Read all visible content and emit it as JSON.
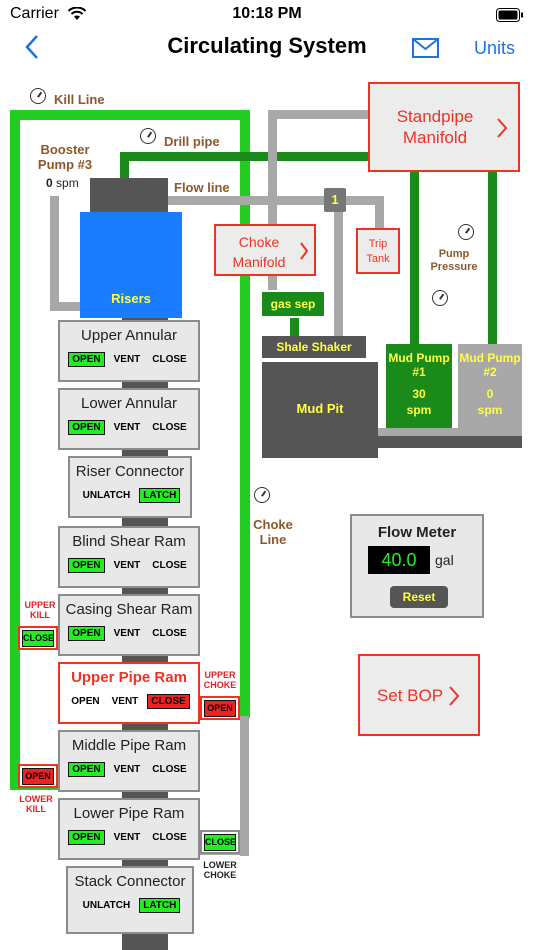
{
  "status_bar": {
    "carrier": "Carrier",
    "time": "10:18 PM"
  },
  "nav": {
    "title": "Circulating System",
    "units": "Units",
    "back_icon": "chevron-left-icon",
    "mail_icon": "mail-icon"
  },
  "colors": {
    "kill_line": "#22cc22",
    "drill_pipe": "#1a8a1a",
    "choke_line": "#a8a8a8",
    "accent": "#1a73e8",
    "alert": "#ee3322"
  },
  "labels": {
    "kill_line": "Kill Line",
    "drill_pipe": "Drill pipe",
    "booster_pump": "Booster Pump #3",
    "booster_value": "0",
    "booster_unit": "spm",
    "flow_line": "Flow line",
    "risers": "Risers",
    "choke_line": "Choke Line",
    "pump_pressure": "Pump Pressure",
    "gas_sep": "gas sep",
    "shale_shaker": "Shale Shaker",
    "mud_pit": "Mud Pit",
    "valve_marker": "1"
  },
  "buttons": {
    "standpipe_manifold": "Standpipe Manifold",
    "choke_manifold": "Choke Manifold",
    "trip_tank": "Trip Tank",
    "set_bop": "Set BOP"
  },
  "pumps": [
    {
      "name": "Mud Pump #1",
      "value": "30",
      "unit": "spm"
    },
    {
      "name": "Mud Pump #2",
      "value": "0",
      "unit": "spm"
    }
  ],
  "flow_meter": {
    "title": "Flow Meter",
    "value": "40.0",
    "unit": "gal",
    "reset": "Reset"
  },
  "bop_stack": [
    {
      "title": "Upper Annular",
      "buttons": [
        "OPEN",
        "VENT",
        "CLOSE"
      ],
      "active": 0
    },
    {
      "title": "Lower Annular",
      "buttons": [
        "OPEN",
        "VENT",
        "CLOSE"
      ],
      "active": 0
    },
    {
      "title": "Riser Connector",
      "buttons": [
        "UNLATCH",
        "LATCH"
      ],
      "active": 1
    },
    {
      "title": "Blind Shear Ram",
      "buttons": [
        "OPEN",
        "VENT",
        "CLOSE"
      ],
      "active": 0
    },
    {
      "title": "Casing Shear Ram",
      "buttons": [
        "OPEN",
        "VENT",
        "CLOSE"
      ],
      "active": 0
    },
    {
      "title": "Upper Pipe Ram",
      "buttons": [
        "OPEN",
        "VENT",
        "CLOSE"
      ],
      "active": 2
    },
    {
      "title": "Middle Pipe Ram",
      "buttons": [
        "OPEN",
        "VENT",
        "CLOSE"
      ],
      "active": 0
    },
    {
      "title": "Lower Pipe Ram",
      "buttons": [
        "OPEN",
        "VENT",
        "CLOSE"
      ],
      "active": 0
    },
    {
      "title": "Stack Connector",
      "buttons": [
        "UNLATCH",
        "LATCH"
      ],
      "active": 1
    }
  ],
  "side_valves": {
    "upper_kill": {
      "label": "UPPER KILL",
      "state": "CLOSE"
    },
    "lower_kill": {
      "label": "LOWER KILL",
      "state": "OPEN"
    },
    "upper_choke": {
      "label": "UPPER CHOKE",
      "state": "OPEN"
    },
    "lower_choke": {
      "label": "LOWER CHOKE",
      "state": "CLOSE"
    }
  }
}
